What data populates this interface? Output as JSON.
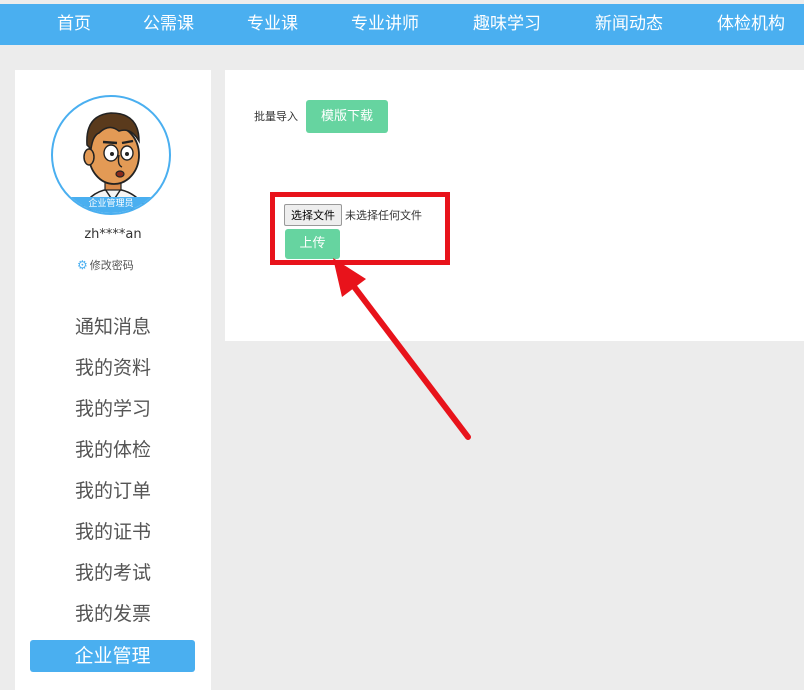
{
  "topnav": {
    "items": [
      "首页",
      "公需课",
      "专业课",
      "专业讲师",
      "趣味学习",
      "新闻动态",
      "体检机构"
    ]
  },
  "sidebar": {
    "avatar_badge": "企业管理员",
    "username": "zh****an",
    "change_password": "修改密码",
    "menu": [
      "通知消息",
      "我的资料",
      "我的学习",
      "我的体检",
      "我的订单",
      "我的证书",
      "我的考试",
      "我的发票",
      "企业管理"
    ],
    "active_item": "企业管理"
  },
  "main": {
    "batch_import_label": "批量导入",
    "template_download": "模版下载",
    "choose_file": "选择文件",
    "no_file_selected": "未选择任何文件",
    "upload": "上传"
  },
  "colors": {
    "brand_blue": "#4aaff0",
    "green_button": "#66d4a0",
    "annotation_red": "#e8131b",
    "page_bg": "#ececec"
  }
}
